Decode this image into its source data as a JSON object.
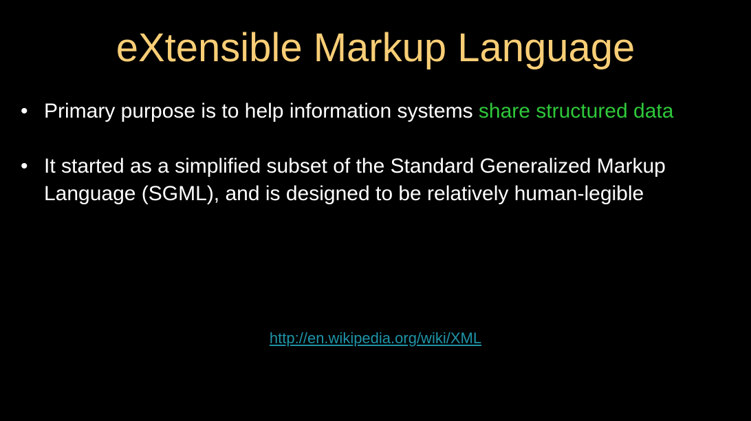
{
  "colors": {
    "background": "#000000",
    "title": "#F9CE76",
    "body_text": "#FFFFFF",
    "highlight": "#2FC93B",
    "link": "#1F94A8"
  },
  "slide": {
    "title": "eXtensible Markup Language",
    "bullet_glyph": "•",
    "bullets": [
      {
        "text": "Primary purpose is to help information systems ",
        "highlight": "share structured data"
      },
      {
        "text": "It started as a simplified subset of the Standard Generalized Markup Language (SGML), and is designed to be relatively human-legible"
      }
    ],
    "link_text": "http://en.wikipedia.org/wiki/XML"
  }
}
